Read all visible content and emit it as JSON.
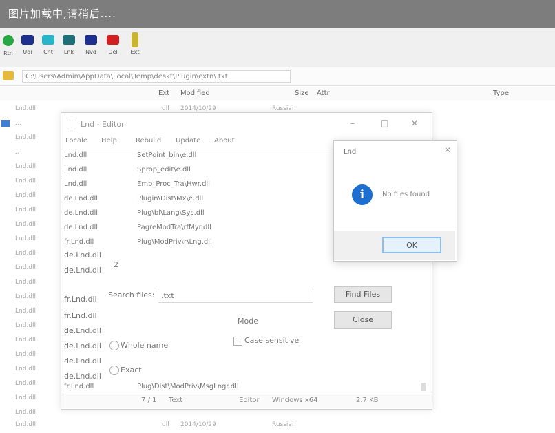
{
  "banner": {
    "text": "图片加载中,请稍后...."
  },
  "toolbar": {
    "buttons": [
      {
        "label": "Rtn",
        "icon": "back-icon",
        "color": "#27a844"
      },
      {
        "label": "Udi",
        "icon": "tool-icon",
        "color": "#1d2f8f"
      },
      {
        "label": "Cnt",
        "icon": "tool-icon",
        "color": "#27b5c9"
      },
      {
        "label": "Lnk",
        "icon": "tool-icon",
        "color": "#1f6f7a"
      },
      {
        "label": "Nvd",
        "icon": "tool-icon",
        "color": "#1d2f8f"
      },
      {
        "label": "Del",
        "icon": "delete-icon",
        "color": "#d21f1f"
      },
      {
        "label": "Ext",
        "icon": "exit-icon",
        "color": "#c8b42e"
      }
    ]
  },
  "addressbar": {
    "path": "C:\\Users\\Admin\\AppData\\Local\\Temp\\deskt\\Plugin\\extn\\.txt"
  },
  "list": {
    "header": {
      "name": "",
      "ext": "Ext",
      "date": "Modified",
      "size": "Size",
      "attr": "Attr",
      "type": "Type"
    },
    "rows": [
      {
        "name": "Lnd.dll",
        "ext": "dll",
        "date": "2014/10/29",
        "comment": "Russian"
      },
      {
        "name": "...",
        "ext": "",
        "date": "",
        "comment": ""
      },
      {
        "name": "Lnd.dll",
        "ext": "",
        "date": "",
        "comment": ""
      },
      {
        "name": "..",
        "ext": "",
        "date": "",
        "comment": ""
      },
      {
        "name": "Lnd.dll",
        "ext": "",
        "date": "",
        "comment": ""
      },
      {
        "name": "Lnd.dll",
        "ext": "",
        "date": "",
        "comment": ""
      },
      {
        "name": "Lnd.dll",
        "ext": "",
        "date": "",
        "comment": ""
      },
      {
        "name": "Lnd.dll",
        "ext": "",
        "date": "",
        "comment": ""
      },
      {
        "name": "Lnd.dll",
        "ext": "",
        "date": "",
        "comment": ""
      },
      {
        "name": "Lnd.dll",
        "ext": "",
        "date": "",
        "comment": ""
      },
      {
        "name": "Lnd.dll",
        "ext": "",
        "date": "",
        "comment": ""
      },
      {
        "name": "Lnd.dll",
        "ext": "",
        "date": "",
        "comment": ""
      },
      {
        "name": "Lnd.dll",
        "ext": "",
        "date": "",
        "comment": ""
      },
      {
        "name": "Lnd.dll",
        "ext": "",
        "date": "",
        "comment": ""
      },
      {
        "name": "Lnd.dll",
        "ext": "",
        "date": "",
        "comment": ""
      },
      {
        "name": "Lnd.dll",
        "ext": "",
        "date": "",
        "comment": ""
      },
      {
        "name": "Lnd.dll",
        "ext": "",
        "date": "",
        "comment": ""
      },
      {
        "name": "Lnd.dll",
        "ext": "",
        "date": "",
        "comment": ""
      },
      {
        "name": "Lnd.dll",
        "ext": "",
        "date": "",
        "comment": ""
      },
      {
        "name": "Lnd.dll",
        "ext": "",
        "date": "",
        "comment": ""
      },
      {
        "name": "Lnd.dll",
        "ext": "",
        "date": "",
        "comment": ""
      },
      {
        "name": "Lnd.dll",
        "ext": "",
        "date": "",
        "comment": ""
      },
      {
        "name": "Lnd.dll",
        "ext": "dll",
        "date": "2014/10/29",
        "comment": "Russian"
      }
    ]
  },
  "dialog": {
    "title": "Lnd - Editor",
    "menu": [
      "Locale",
      "Help",
      "Rebuild",
      "Update",
      "About"
    ],
    "rows": [
      {
        "name": "Lnd.dll",
        "path": "SetPoint_bin\\e.dll"
      },
      {
        "name": "Lnd.dll",
        "path": "Sprop_edit\\e.dll"
      },
      {
        "name": "Lnd.dll",
        "path": "Emb_Proc_Tra\\Hwr.dll"
      },
      {
        "name": "de.Lnd.dll",
        "path": "Plugin\\Dist\\Mx\\e.dll"
      },
      {
        "name": "de.Lnd.dll",
        "path": "Plug\\bl\\Lang\\Sys.dll"
      },
      {
        "name": "de.Lnd.dll",
        "path": "PagreModTra\\rfMyr.dll"
      },
      {
        "name": "fr.Lnd.dll",
        "path": "Plug\\ModPriv\\r\\Lng.dll"
      }
    ],
    "extra_rows": [
      {
        "name": "de.Lnd.dll"
      },
      {
        "name": "de.Lnd.dll"
      },
      {
        "name": "fr.Lnd.dll"
      },
      {
        "name": "fr.Lnd.dll"
      },
      {
        "name": "de.Lnd.dll"
      },
      {
        "name": "de.Lnd.dll"
      },
      {
        "name": "de.Lnd.dll"
      },
      {
        "name": "de.Lnd.dll"
      },
      {
        "name": "fr.Lnd.dll"
      }
    ],
    "count_label": "2",
    "search_label": "Search files:",
    "search_value": ".txt",
    "find_button": "Find Files",
    "close_button": "Close",
    "mode_label": "Mode",
    "radio1_label": "Whole name",
    "checkbox_label": "Case sensitive",
    "radio2_label": "Exact",
    "bottom_row": {
      "name": "fr.Lnd.dll",
      "path": "Plug\\Dist\\ModPriv\\MsgLngr.dll"
    },
    "status": {
      "count": "7 / 1",
      "item": "Text",
      "mode": "Editor",
      "os": "Windows x64",
      "size": "2.7 KB"
    }
  },
  "message": {
    "title": "Lnd",
    "text": "No files found",
    "ok_button": "OK",
    "info_glyph": "i"
  }
}
